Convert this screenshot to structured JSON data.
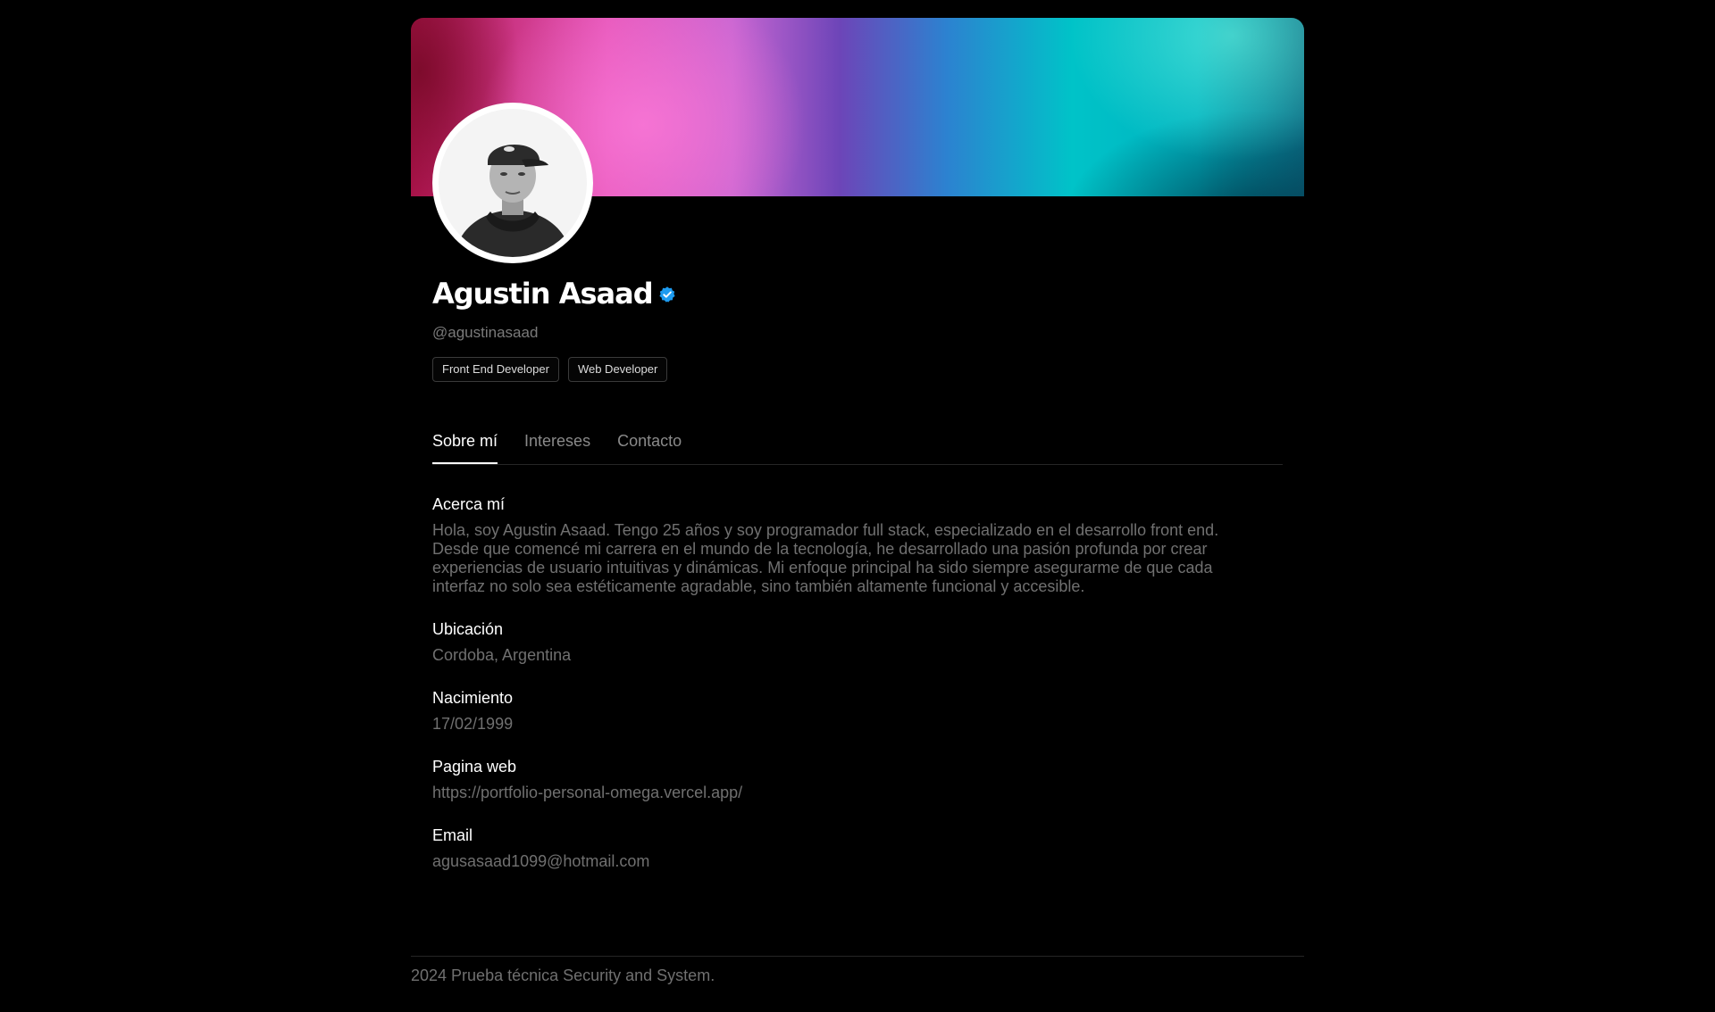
{
  "profile": {
    "name": "Agustin Asaad",
    "handle": "@agustinasaad",
    "tags": [
      "Front End Developer",
      "Web Developer"
    ]
  },
  "tabs": [
    {
      "label": "Sobre mí",
      "active": true
    },
    {
      "label": "Intereses",
      "active": false
    },
    {
      "label": "Contacto",
      "active": false
    }
  ],
  "about": {
    "title": "Acerca mí",
    "text": "Hola, soy Agustin Asaad. Tengo 25 años y soy programador full stack, especializado en el desarrollo front end. Desde que comencé mi carrera en el mundo de la tecnología, he desarrollado una pasión profunda por crear experiencias de usuario intuitivas y dinámicas. Mi enfoque principal ha sido siempre asegurarme de que cada interfaz no solo sea estéticamente agradable, sino también altamente funcional y accesible."
  },
  "location": {
    "title": "Ubicación",
    "value": "Cordoba, Argentina"
  },
  "birth": {
    "title": "Nacimiento",
    "value": "17/02/1999"
  },
  "website": {
    "title": "Pagina web",
    "value": "https://portfolio-personal-omega.vercel.app/"
  },
  "email": {
    "title": "Email",
    "value": "agusasaad1099@hotmail.com"
  },
  "footer": {
    "text": "2024 Prueba técnica Security and System."
  },
  "colors": {
    "background": "#000000",
    "verified": "#1d9bf0",
    "muted_text": "#707070"
  }
}
